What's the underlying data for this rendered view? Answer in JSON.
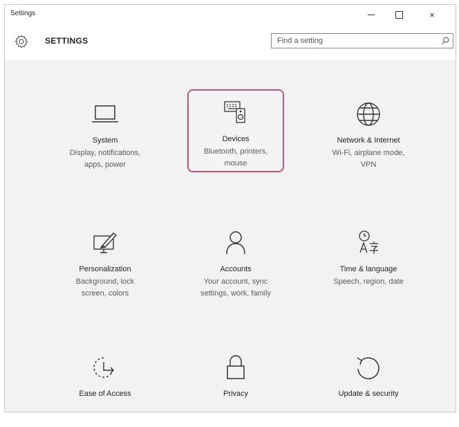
{
  "window": {
    "title": "Settings",
    "minimize_icon": "minimize-icon",
    "maximize_icon": "maximize-icon",
    "close_label": "×"
  },
  "header": {
    "title": "SETTINGS",
    "icon": "gear-icon"
  },
  "search": {
    "placeholder": "Find a setting",
    "icon": "search-icon"
  },
  "tiles": [
    {
      "name": "System",
      "desc1": "Display, notifications,",
      "desc2": "apps, power",
      "icon": "laptop-icon"
    },
    {
      "name": "Devices",
      "desc1": "Bluetooth, printers,",
      "desc2": "mouse",
      "icon": "devices-icon",
      "selected": true
    },
    {
      "name": "Network & Internet",
      "desc1": "Wi-Fi, airplane mode,",
      "desc2": "VPN",
      "icon": "globe-icon"
    },
    {
      "name": "Personalization",
      "desc1": "Background, lock",
      "desc2": "screen, colors",
      "icon": "personalization-icon"
    },
    {
      "name": "Accounts",
      "desc1": "Your account, sync",
      "desc2": "settings, work, family",
      "icon": "person-icon"
    },
    {
      "name": "Time & language",
      "desc1": "Speech, region, date",
      "desc2": "",
      "icon": "time-language-icon"
    },
    {
      "name": "Ease of Access",
      "desc1": "",
      "desc2": "",
      "icon": "ease-of-access-icon"
    },
    {
      "name": "Privacy",
      "desc1": "",
      "desc2": "",
      "icon": "lock-icon"
    },
    {
      "name": "Update & security",
      "desc1": "",
      "desc2": "",
      "icon": "update-icon"
    }
  ],
  "colors": {
    "selection_border": "#b5567e",
    "window_background": "#f2f2f2"
  }
}
